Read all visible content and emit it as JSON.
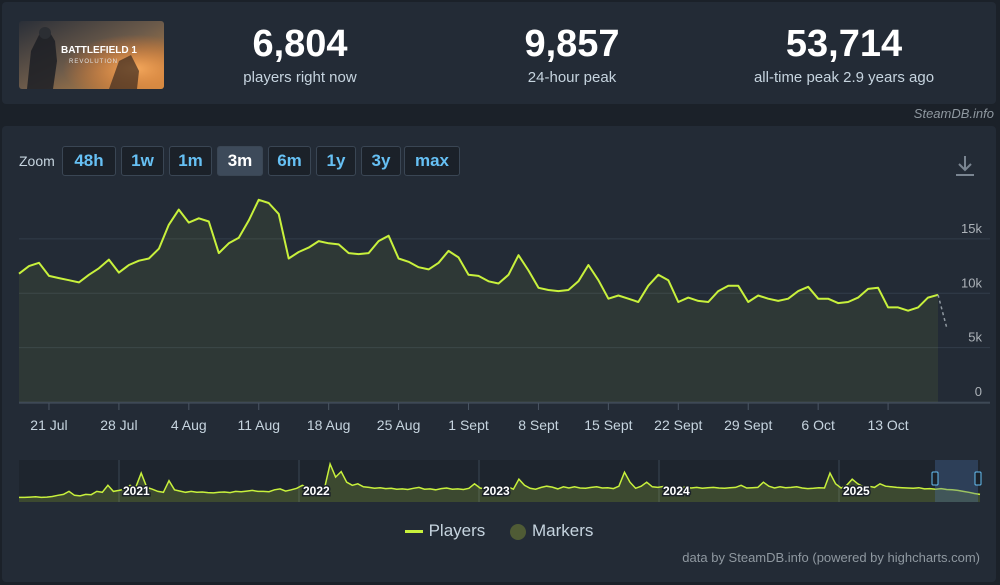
{
  "header": {
    "game_thumb_line1": "BATTLEFIELD 1",
    "game_thumb_line2": "REVOLUTION",
    "stats": [
      {
        "value": "6,804",
        "label": "players right now"
      },
      {
        "value": "9,857",
        "label": "24-hour peak"
      },
      {
        "value": "53,714",
        "label": "all-time peak 2.9 years ago"
      }
    ],
    "credit": "SteamDB.info"
  },
  "zoom": {
    "label": "Zoom",
    "buttons": [
      "48h",
      "1w",
      "1m",
      "3m",
      "6m",
      "1y",
      "3y",
      "max"
    ],
    "active": "3m"
  },
  "colors": {
    "series": "#c8f13c",
    "marker": "#4f5b35",
    "link": "#66c0f4"
  },
  "chart_data": [
    {
      "type": "line",
      "y_ticks": [
        "0",
        "5k",
        "10k",
        "15k"
      ],
      "ylim": [
        0,
        19500
      ],
      "xlim": [
        "2025-07-18",
        "2025-10-21"
      ],
      "x_ticks": [
        "21 Jul",
        "28 Jul",
        "4 Aug",
        "11 Aug",
        "18 Aug",
        "25 Aug",
        "1 Sept",
        "8 Sept",
        "15 Sept",
        "22 Sept",
        "29 Sept",
        "6 Oct",
        "13 Oct"
      ],
      "grid": true,
      "series": [
        {
          "name": "Players",
          "x": [
            "2025-07-18",
            "2025-07-19",
            "2025-07-20",
            "2025-07-21",
            "2025-07-22",
            "2025-07-23",
            "2025-07-24",
            "2025-07-25",
            "2025-07-26",
            "2025-07-27",
            "2025-07-28",
            "2025-07-29",
            "2025-07-30",
            "2025-07-31",
            "2025-08-01",
            "2025-08-02",
            "2025-08-03",
            "2025-08-04",
            "2025-08-05",
            "2025-08-06",
            "2025-08-07",
            "2025-08-08",
            "2025-08-09",
            "2025-08-10",
            "2025-08-11",
            "2025-08-12",
            "2025-08-13",
            "2025-08-14",
            "2025-08-15",
            "2025-08-16",
            "2025-08-17",
            "2025-08-18",
            "2025-08-19",
            "2025-08-20",
            "2025-08-21",
            "2025-08-22",
            "2025-08-23",
            "2025-08-24",
            "2025-08-25",
            "2025-08-26",
            "2025-08-27",
            "2025-08-28",
            "2025-08-29",
            "2025-08-30",
            "2025-08-31",
            "2025-09-01",
            "2025-09-02",
            "2025-09-03",
            "2025-09-04",
            "2025-09-05",
            "2025-09-06",
            "2025-09-07",
            "2025-09-08",
            "2025-09-09",
            "2025-09-10",
            "2025-09-11",
            "2025-09-12",
            "2025-09-13",
            "2025-09-14",
            "2025-09-15",
            "2025-09-16",
            "2025-09-17",
            "2025-09-18",
            "2025-09-19",
            "2025-09-20",
            "2025-09-21",
            "2025-09-22",
            "2025-09-23",
            "2025-09-24",
            "2025-09-25",
            "2025-09-26",
            "2025-09-27",
            "2025-09-28",
            "2025-09-29",
            "2025-09-30",
            "2025-10-01",
            "2025-10-02",
            "2025-10-03",
            "2025-10-04",
            "2025-10-05",
            "2025-10-06",
            "2025-10-07",
            "2025-10-08",
            "2025-10-09",
            "2025-10-10",
            "2025-10-11",
            "2025-10-12",
            "2025-10-13",
            "2025-10-14",
            "2025-10-15",
            "2025-10-16",
            "2025-10-17",
            "2025-10-18"
          ],
          "values": [
            11800,
            12500,
            12800,
            11600,
            11400,
            11200,
            11000,
            11700,
            12300,
            13100,
            11900,
            12600,
            13000,
            13200,
            14100,
            16300,
            17700,
            16500,
            16900,
            16600,
            13700,
            14600,
            15100,
            16700,
            18600,
            18300,
            17300,
            13200,
            13800,
            14200,
            14800,
            14600,
            14500,
            13700,
            13600,
            13700,
            14800,
            15300,
            13200,
            12900,
            12400,
            12200,
            12800,
            13900,
            13300,
            11700,
            11600,
            11100,
            10900,
            11700,
            13500,
            12100,
            10500,
            10300,
            10200,
            10300,
            11100,
            12600,
            11200,
            9500,
            9800,
            9500,
            9200,
            10700,
            11700,
            11200,
            9200,
            9600,
            9300,
            9200,
            10200,
            10700,
            10700,
            9200,
            9800,
            9500,
            9300,
            9500,
            10200,
            10600,
            9500,
            9500,
            9100,
            9200,
            9600,
            10400,
            10500,
            8700,
            8700,
            8400,
            8700,
            9600,
            9857
          ],
          "color": "#c8f13c"
        }
      ]
    },
    {
      "type": "area",
      "x_ticks": [
        "2021",
        "2022",
        "2023",
        "2024",
        "2025"
      ],
      "series": [
        {
          "values": [
            1500,
            1500,
            1600,
            1700,
            1500,
            1600,
            1800,
            2200,
            2500,
            3500,
            2200,
            2000,
            2500,
            2400,
            3500,
            3200,
            5500,
            3500,
            3800,
            4200,
            5500,
            4800,
            9500,
            4800,
            4200,
            3500,
            3200,
            7000,
            4000,
            3600,
            3200,
            3500,
            3200,
            3300,
            3100,
            3000,
            3200,
            3300,
            3100,
            3500,
            3400,
            3600,
            3800,
            3500,
            3500,
            3400,
            4000,
            4300,
            3600,
            4000,
            4500,
            5500,
            4800,
            5200,
            4000,
            4500,
            12500,
            8200,
            10000,
            6500,
            5500,
            6000,
            5000,
            4800,
            4500,
            4700,
            4400,
            4500,
            4200,
            4300,
            4100,
            4500,
            4800,
            4200,
            4300,
            4000,
            4400,
            4600,
            4200,
            4300,
            4100,
            4500,
            6000,
            4600,
            4200,
            4400,
            4000,
            4500,
            5000,
            4200,
            7500,
            5500,
            4500,
            4200,
            4800,
            5200,
            4900,
            4300,
            5000,
            4600,
            5000,
            4600,
            4500,
            4800,
            5000,
            4600,
            4700,
            4400,
            5200,
            9800,
            6500,
            4500,
            5200,
            6500,
            5000,
            4800,
            5100,
            4600,
            4800,
            4700,
            4900,
            4600,
            4800,
            4500,
            4700,
            4800,
            4600,
            4500,
            4700,
            4800,
            5500,
            4600,
            4700,
            4800,
            6500,
            5200,
            4600,
            5000,
            4700,
            4800,
            5000,
            4600,
            4400,
            4500,
            4700,
            4600,
            9500,
            6000,
            4600,
            5500,
            7500,
            6000,
            5000,
            5200,
            4800,
            6000,
            5200,
            5000,
            4800,
            4700,
            4600,
            4500,
            4700,
            4300,
            4400,
            4200,
            4400,
            4100,
            4000,
            3800,
            3500,
            3200,
            2800,
            2500
          ],
          "color": "#c8f13c"
        }
      ]
    }
  ],
  "legend": {
    "players": "Players",
    "markers": "Markers"
  },
  "footer": {
    "credit": "data by SteamDB.info (powered by highcharts.com)"
  }
}
